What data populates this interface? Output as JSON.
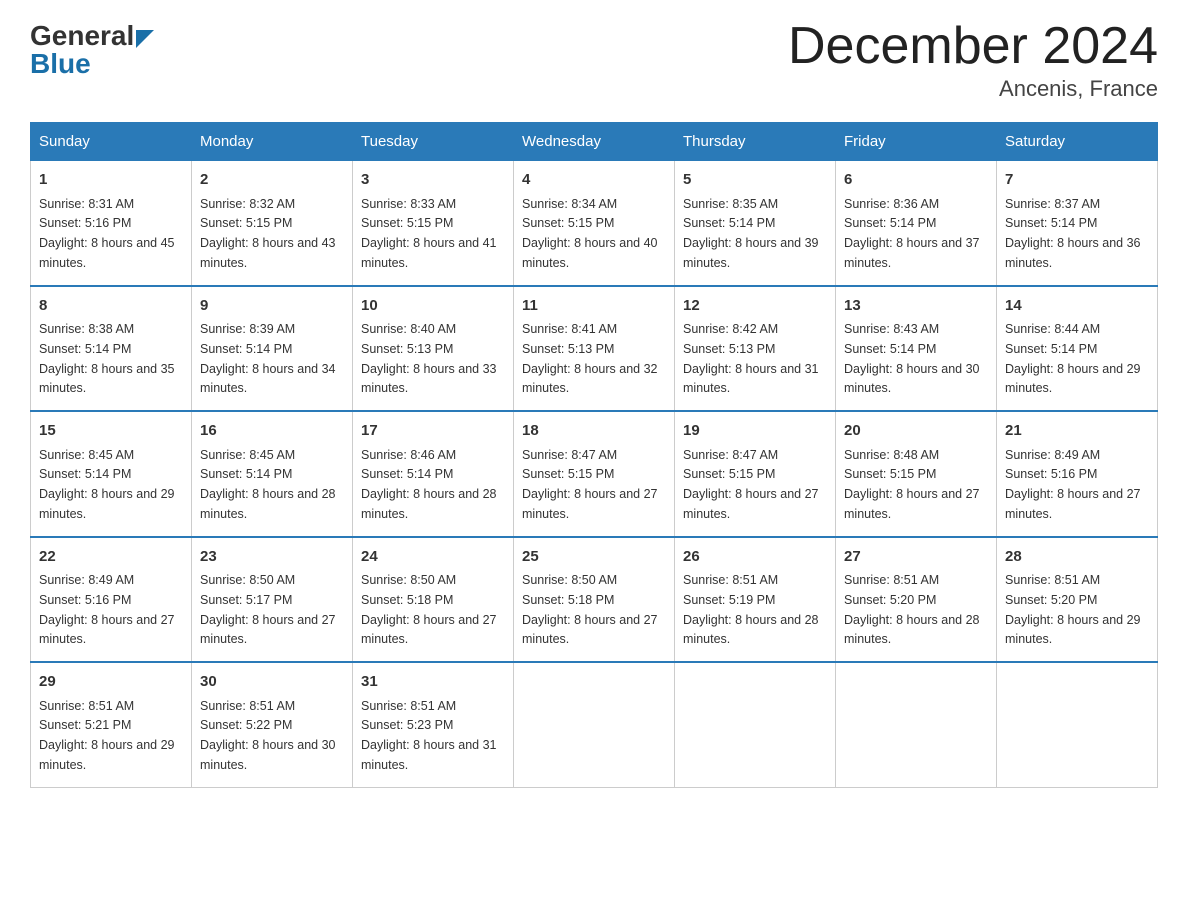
{
  "header": {
    "logo": {
      "general": "General",
      "blue": "Blue"
    },
    "title": "December 2024",
    "location": "Ancenis, France"
  },
  "calendar": {
    "days_of_week": [
      "Sunday",
      "Monday",
      "Tuesday",
      "Wednesday",
      "Thursday",
      "Friday",
      "Saturday"
    ],
    "weeks": [
      [
        {
          "day": "1",
          "sunrise": "Sunrise: 8:31 AM",
          "sunset": "Sunset: 5:16 PM",
          "daylight": "Daylight: 8 hours and 45 minutes."
        },
        {
          "day": "2",
          "sunrise": "Sunrise: 8:32 AM",
          "sunset": "Sunset: 5:15 PM",
          "daylight": "Daylight: 8 hours and 43 minutes."
        },
        {
          "day": "3",
          "sunrise": "Sunrise: 8:33 AM",
          "sunset": "Sunset: 5:15 PM",
          "daylight": "Daylight: 8 hours and 41 minutes."
        },
        {
          "day": "4",
          "sunrise": "Sunrise: 8:34 AM",
          "sunset": "Sunset: 5:15 PM",
          "daylight": "Daylight: 8 hours and 40 minutes."
        },
        {
          "day": "5",
          "sunrise": "Sunrise: 8:35 AM",
          "sunset": "Sunset: 5:14 PM",
          "daylight": "Daylight: 8 hours and 39 minutes."
        },
        {
          "day": "6",
          "sunrise": "Sunrise: 8:36 AM",
          "sunset": "Sunset: 5:14 PM",
          "daylight": "Daylight: 8 hours and 37 minutes."
        },
        {
          "day": "7",
          "sunrise": "Sunrise: 8:37 AM",
          "sunset": "Sunset: 5:14 PM",
          "daylight": "Daylight: 8 hours and 36 minutes."
        }
      ],
      [
        {
          "day": "8",
          "sunrise": "Sunrise: 8:38 AM",
          "sunset": "Sunset: 5:14 PM",
          "daylight": "Daylight: 8 hours and 35 minutes."
        },
        {
          "day": "9",
          "sunrise": "Sunrise: 8:39 AM",
          "sunset": "Sunset: 5:14 PM",
          "daylight": "Daylight: 8 hours and 34 minutes."
        },
        {
          "day": "10",
          "sunrise": "Sunrise: 8:40 AM",
          "sunset": "Sunset: 5:13 PM",
          "daylight": "Daylight: 8 hours and 33 minutes."
        },
        {
          "day": "11",
          "sunrise": "Sunrise: 8:41 AM",
          "sunset": "Sunset: 5:13 PM",
          "daylight": "Daylight: 8 hours and 32 minutes."
        },
        {
          "day": "12",
          "sunrise": "Sunrise: 8:42 AM",
          "sunset": "Sunset: 5:13 PM",
          "daylight": "Daylight: 8 hours and 31 minutes."
        },
        {
          "day": "13",
          "sunrise": "Sunrise: 8:43 AM",
          "sunset": "Sunset: 5:14 PM",
          "daylight": "Daylight: 8 hours and 30 minutes."
        },
        {
          "day": "14",
          "sunrise": "Sunrise: 8:44 AM",
          "sunset": "Sunset: 5:14 PM",
          "daylight": "Daylight: 8 hours and 29 minutes."
        }
      ],
      [
        {
          "day": "15",
          "sunrise": "Sunrise: 8:45 AM",
          "sunset": "Sunset: 5:14 PM",
          "daylight": "Daylight: 8 hours and 29 minutes."
        },
        {
          "day": "16",
          "sunrise": "Sunrise: 8:45 AM",
          "sunset": "Sunset: 5:14 PM",
          "daylight": "Daylight: 8 hours and 28 minutes."
        },
        {
          "day": "17",
          "sunrise": "Sunrise: 8:46 AM",
          "sunset": "Sunset: 5:14 PM",
          "daylight": "Daylight: 8 hours and 28 minutes."
        },
        {
          "day": "18",
          "sunrise": "Sunrise: 8:47 AM",
          "sunset": "Sunset: 5:15 PM",
          "daylight": "Daylight: 8 hours and 27 minutes."
        },
        {
          "day": "19",
          "sunrise": "Sunrise: 8:47 AM",
          "sunset": "Sunset: 5:15 PM",
          "daylight": "Daylight: 8 hours and 27 minutes."
        },
        {
          "day": "20",
          "sunrise": "Sunrise: 8:48 AM",
          "sunset": "Sunset: 5:15 PM",
          "daylight": "Daylight: 8 hours and 27 minutes."
        },
        {
          "day": "21",
          "sunrise": "Sunrise: 8:49 AM",
          "sunset": "Sunset: 5:16 PM",
          "daylight": "Daylight: 8 hours and 27 minutes."
        }
      ],
      [
        {
          "day": "22",
          "sunrise": "Sunrise: 8:49 AM",
          "sunset": "Sunset: 5:16 PM",
          "daylight": "Daylight: 8 hours and 27 minutes."
        },
        {
          "day": "23",
          "sunrise": "Sunrise: 8:50 AM",
          "sunset": "Sunset: 5:17 PM",
          "daylight": "Daylight: 8 hours and 27 minutes."
        },
        {
          "day": "24",
          "sunrise": "Sunrise: 8:50 AM",
          "sunset": "Sunset: 5:18 PM",
          "daylight": "Daylight: 8 hours and 27 minutes."
        },
        {
          "day": "25",
          "sunrise": "Sunrise: 8:50 AM",
          "sunset": "Sunset: 5:18 PM",
          "daylight": "Daylight: 8 hours and 27 minutes."
        },
        {
          "day": "26",
          "sunrise": "Sunrise: 8:51 AM",
          "sunset": "Sunset: 5:19 PM",
          "daylight": "Daylight: 8 hours and 28 minutes."
        },
        {
          "day": "27",
          "sunrise": "Sunrise: 8:51 AM",
          "sunset": "Sunset: 5:20 PM",
          "daylight": "Daylight: 8 hours and 28 minutes."
        },
        {
          "day": "28",
          "sunrise": "Sunrise: 8:51 AM",
          "sunset": "Sunset: 5:20 PM",
          "daylight": "Daylight: 8 hours and 29 minutes."
        }
      ],
      [
        {
          "day": "29",
          "sunrise": "Sunrise: 8:51 AM",
          "sunset": "Sunset: 5:21 PM",
          "daylight": "Daylight: 8 hours and 29 minutes."
        },
        {
          "day": "30",
          "sunrise": "Sunrise: 8:51 AM",
          "sunset": "Sunset: 5:22 PM",
          "daylight": "Daylight: 8 hours and 30 minutes."
        },
        {
          "day": "31",
          "sunrise": "Sunrise: 8:51 AM",
          "sunset": "Sunset: 5:23 PM",
          "daylight": "Daylight: 8 hours and 31 minutes."
        },
        {
          "day": "",
          "sunrise": "",
          "sunset": "",
          "daylight": ""
        },
        {
          "day": "",
          "sunrise": "",
          "sunset": "",
          "daylight": ""
        },
        {
          "day": "",
          "sunrise": "",
          "sunset": "",
          "daylight": ""
        },
        {
          "day": "",
          "sunrise": "",
          "sunset": "",
          "daylight": ""
        }
      ]
    ]
  }
}
